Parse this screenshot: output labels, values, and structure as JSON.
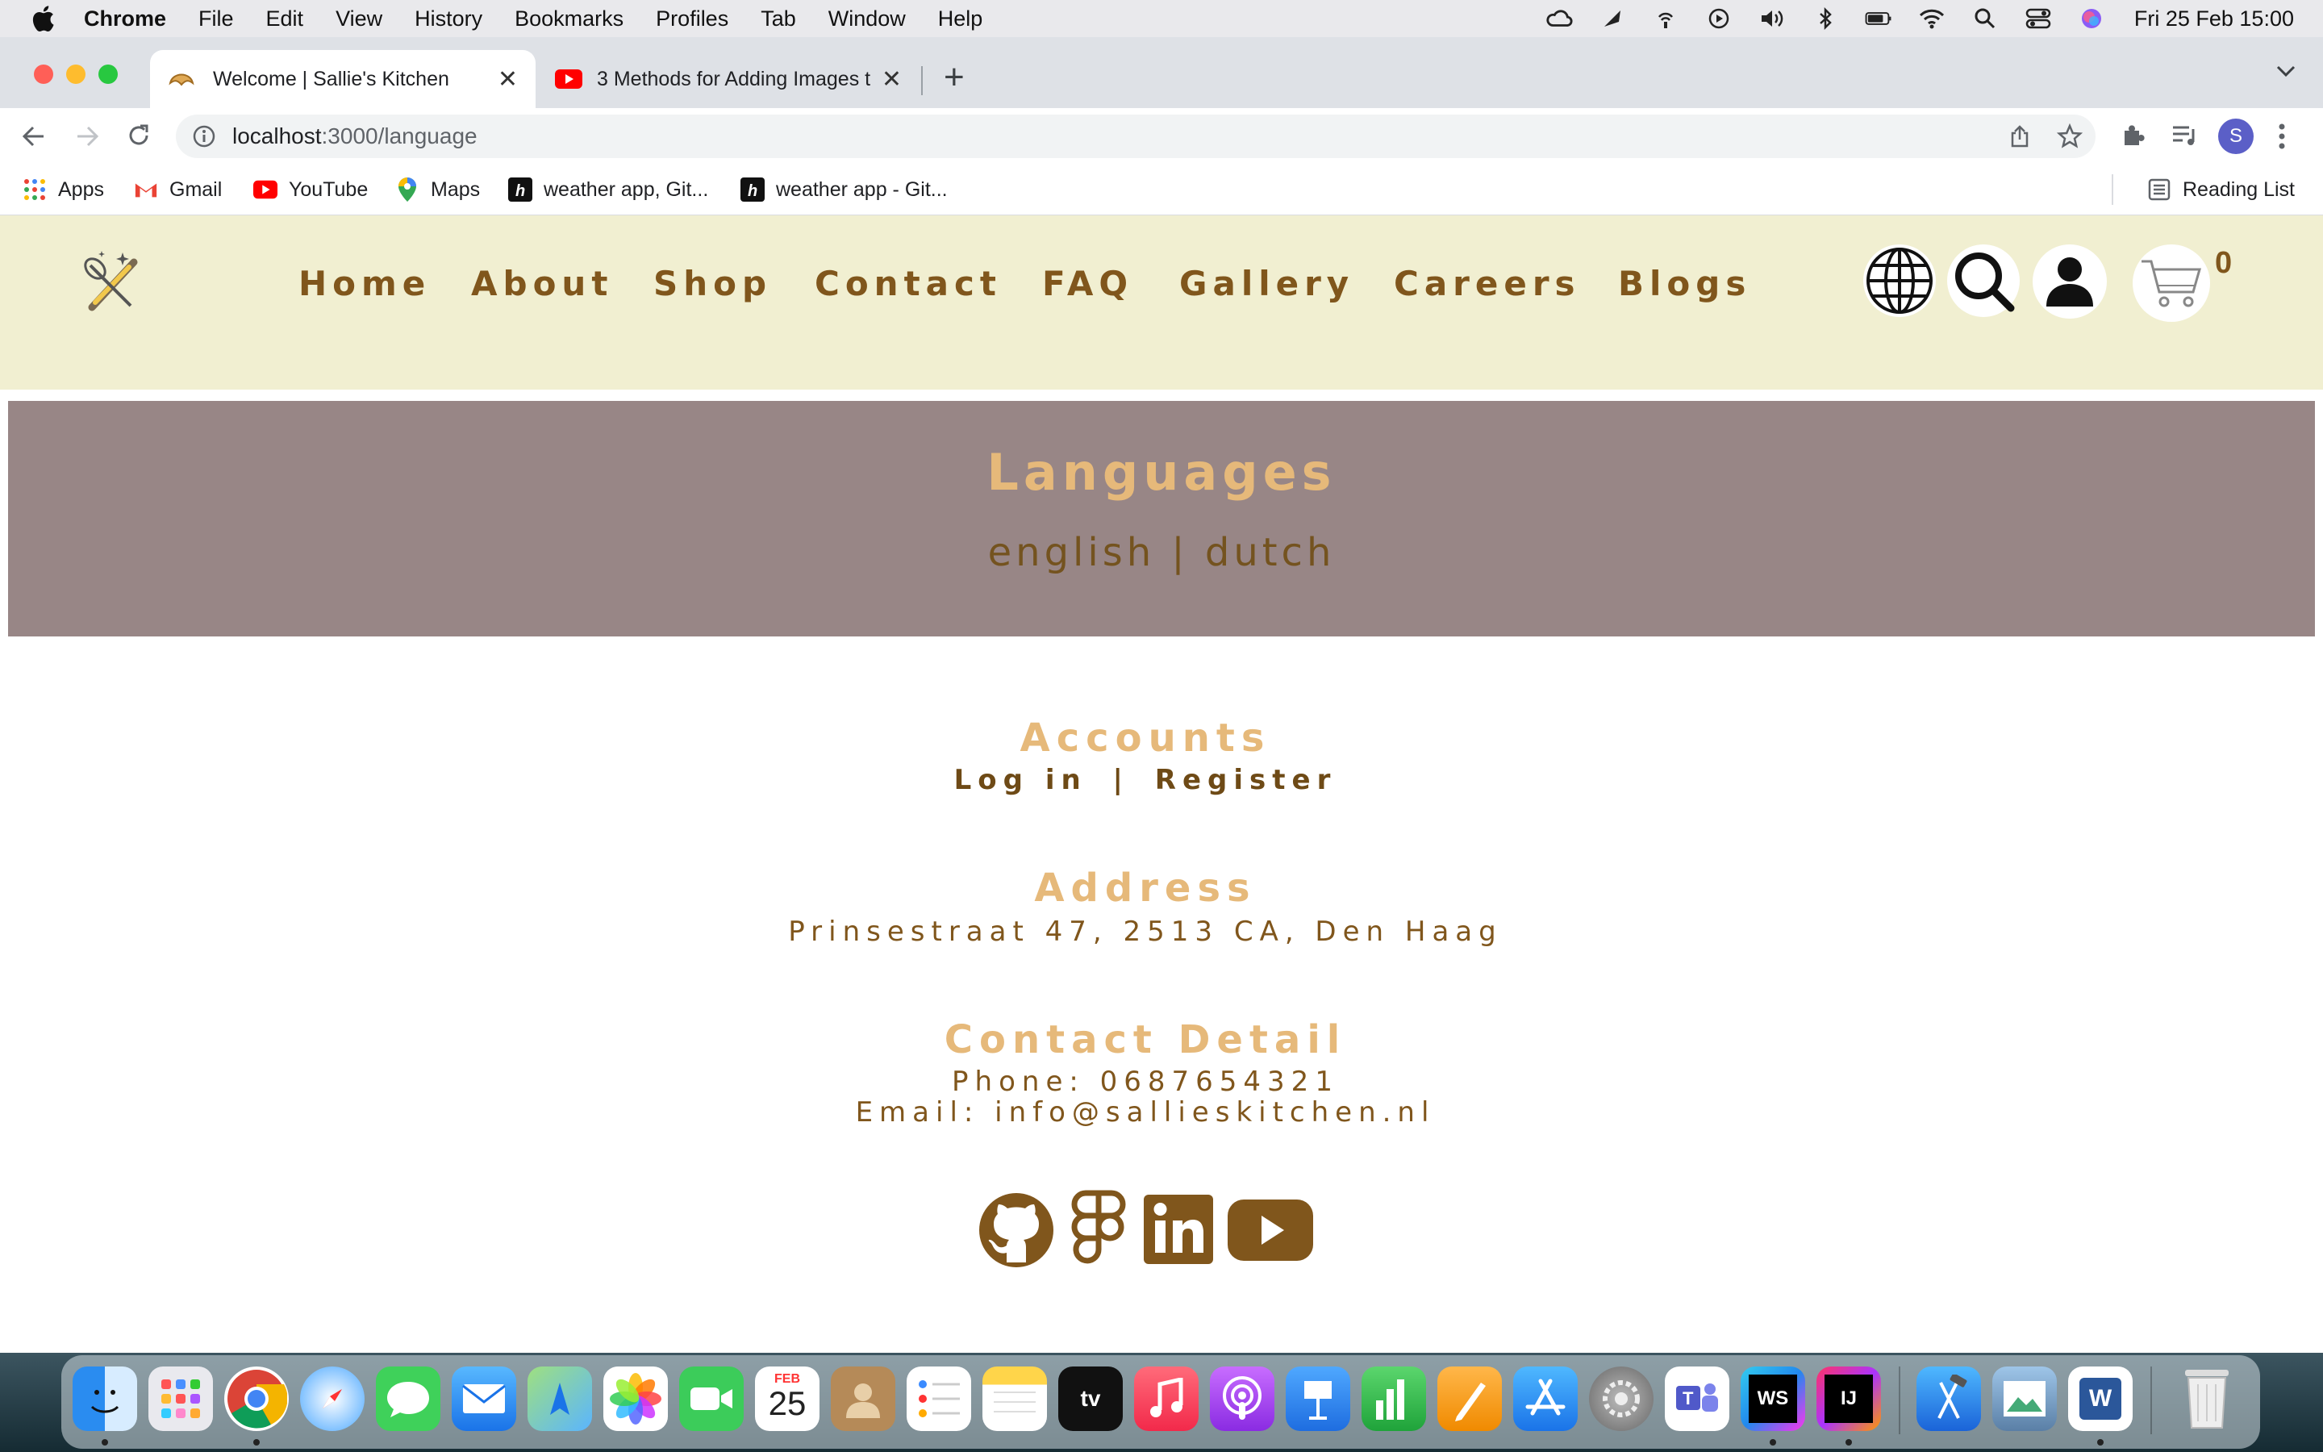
{
  "menubar": {
    "app_name": "Chrome",
    "items": [
      "File",
      "Edit",
      "View",
      "History",
      "Bookmarks",
      "Profiles",
      "Tab",
      "Window",
      "Help"
    ],
    "clock": "Fri 25 Feb  15:00"
  },
  "browser": {
    "tabs": [
      {
        "title": "Welcome | Sallie's Kitchen",
        "icon": "croissant-icon"
      },
      {
        "title": "3 Methods for Adding Images t",
        "icon": "youtube-icon"
      }
    ],
    "url_host": "localhost",
    "url_path": ":3000/language",
    "profile_initial": "S",
    "bookmarks": [
      {
        "label": "Apps",
        "icon": "apps-grid-icon"
      },
      {
        "label": "Gmail",
        "icon": "gmail-icon"
      },
      {
        "label": "YouTube",
        "icon": "youtube-icon"
      },
      {
        "label": "Maps",
        "icon": "maps-icon"
      },
      {
        "label": "weather app, Git...",
        "icon": "heroku-icon"
      },
      {
        "label": "weather app - Git...",
        "icon": "heroku-icon"
      }
    ],
    "reading_list": "Reading List"
  },
  "site": {
    "nav": [
      "Home",
      "About",
      "Shop",
      "Contact",
      "FAQ",
      "Gallery",
      "Careers",
      "Blogs"
    ],
    "cart_count": "0",
    "colors": {
      "nav_bg": "#f1efd1",
      "brown": "#80561c",
      "gold": "#e6b97a",
      "banner": "#988686"
    }
  },
  "languages": {
    "title": "Languages",
    "english": "english",
    "separator": "|",
    "dutch": "dutch"
  },
  "footer": {
    "accounts_heading": "Accounts",
    "login": "Log in",
    "separator": "|",
    "register": "Register",
    "address_heading": "Address",
    "address": "Prinsestraat 47, 2513 CA, Den Haag",
    "contact_heading": "Contact Detail",
    "phone": "Phone: 0687654321",
    "email": "Email: info@sallieskitchen.nl",
    "social": [
      "github-icon",
      "figma-icon",
      "linkedin-icon",
      "youtube-icon"
    ]
  },
  "dock": {
    "apps": [
      "Finder",
      "Launchpad",
      "Chrome",
      "Safari",
      "Messages",
      "Mail",
      "Maps",
      "Photos",
      "FaceTime",
      "Calendar",
      "Contacts",
      "Reminders",
      "Notes",
      "TV",
      "Music",
      "Podcasts",
      "Keynote",
      "Numbers",
      "Pages",
      "App Store",
      "System Preferences",
      "Teams",
      "WebStorm",
      "IntelliJ IDEA",
      "Xcode",
      "Preview",
      "Word",
      "Trash"
    ],
    "calendar_month": "FEB",
    "calendar_day": "25",
    "tv_label": "tv",
    "webstorm_label": "WS",
    "intellij_label": "IJ",
    "word_label": "W",
    "teams_label": "T"
  }
}
